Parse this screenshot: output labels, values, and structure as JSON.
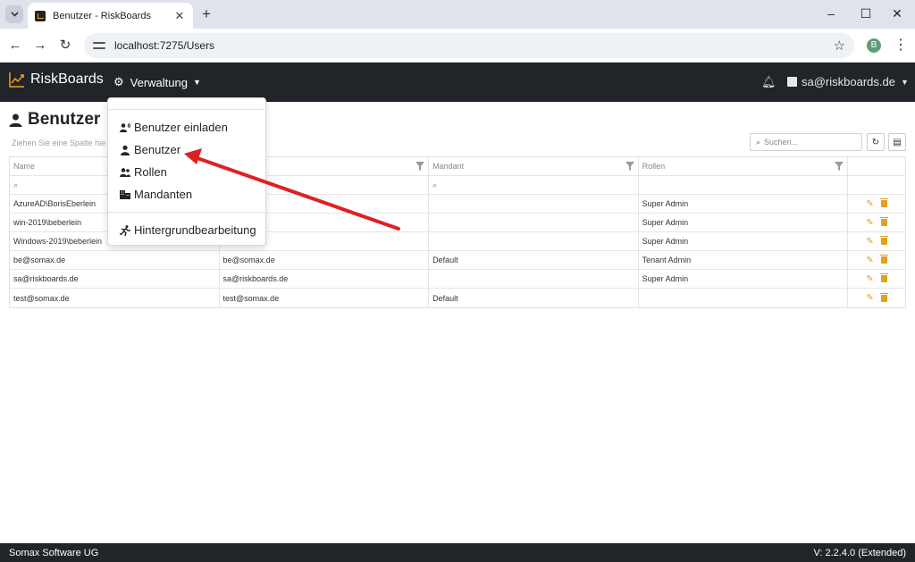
{
  "browser": {
    "tab_title": "Benutzer - RiskBoards",
    "url": "localhost:7275/Users",
    "profile_initial": "B"
  },
  "navbar": {
    "brand": "RiskBoards",
    "menu_label": "Verwaltung",
    "user_email": "sa@riskboards.de"
  },
  "dropdown": {
    "items": [
      {
        "label": "Benutzer einladen",
        "icon": "person-invite-icon"
      },
      {
        "label": "Benutzer",
        "icon": "person-icon"
      },
      {
        "label": "Rollen",
        "icon": "people-icon"
      },
      {
        "label": "Mandanten",
        "icon": "building-icon"
      },
      {
        "label": "Hintergrundbearbeitung",
        "icon": "running-person-icon"
      }
    ]
  },
  "page": {
    "title": "Benutzer",
    "group_hint": "Ziehen Sie eine Spalte hie",
    "search_placeholder": "Suchen..."
  },
  "grid": {
    "columns": [
      "Name",
      "",
      "Mandant",
      "Rollen",
      ""
    ],
    "rows": [
      [
        "AzureAD\\BorisEberlein",
        "",
        "",
        "Super Admin"
      ],
      [
        "win-2019\\beberlein",
        "",
        "",
        "Super Admin"
      ],
      [
        "Windows-2019\\beberlein",
        "",
        "",
        "Super Admin"
      ],
      [
        "be@somax.de",
        "be@somax.de",
        "Default",
        "Tenant Admin"
      ],
      [
        "sa@riskboards.de",
        "sa@riskboards.de",
        "",
        "Super Admin"
      ],
      [
        "test@somax.de",
        "test@somax.de",
        "Default",
        ""
      ]
    ]
  },
  "footer": {
    "company": "Somax Software UG",
    "version": "V: 2.2.4.0 (Extended)"
  },
  "colors": {
    "navbar": "#212529",
    "accent": "#e3a21a",
    "annotation_arrow": "#e02020"
  }
}
